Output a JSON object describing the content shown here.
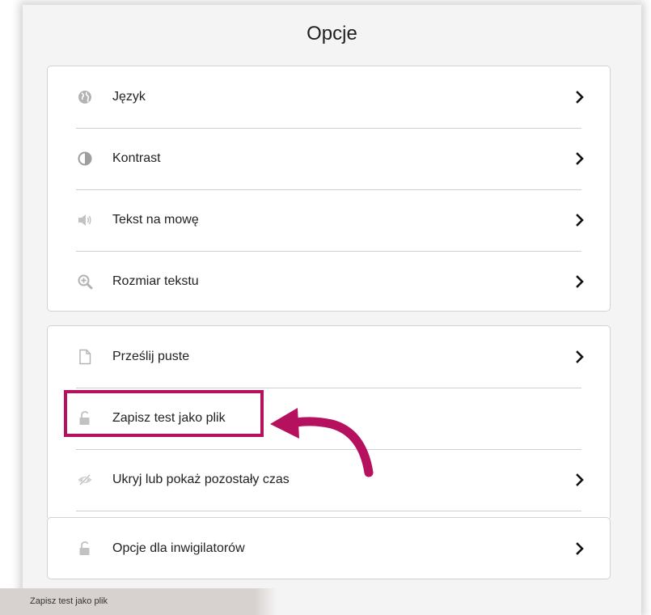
{
  "title": "Opcje",
  "groups": [
    {
      "items": [
        {
          "label": "Język",
          "icon": "globe-icon"
        },
        {
          "label": "Kontrast",
          "icon": "contrast-icon"
        },
        {
          "label": "Tekst na mowę",
          "icon": "speaker-icon"
        },
        {
          "label": "Rozmiar tekstu",
          "icon": "zoom-in-icon"
        }
      ]
    },
    {
      "items": [
        {
          "label": "Prześlij puste",
          "icon": "document-icon"
        },
        {
          "label": "Zapisz test jako plik",
          "icon": "unlock-icon"
        },
        {
          "label": "Ukryj lub pokaż pozostały czas",
          "icon": "eye-slash-icon"
        }
      ]
    },
    {
      "items": [
        {
          "label": "Opcje dla inwigilatorów",
          "icon": "unlock-icon"
        }
      ]
    }
  ],
  "tooltip": {
    "text": "Zapisz test jako plik"
  },
  "colors": {
    "highlight": "#b5115e",
    "icon": "#b3b3b3",
    "panel_bg": "#f4f4f4",
    "card_border": "#d2d2d2"
  }
}
